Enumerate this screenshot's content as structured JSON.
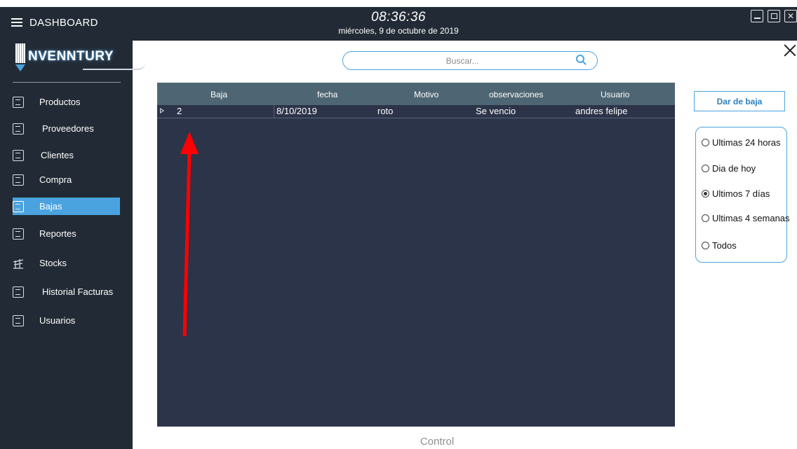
{
  "header": {
    "menu_label": "DASHBOARD",
    "time": "08:36:36",
    "date": "miércoles, 9 de octubre de 2019"
  },
  "sidebar": {
    "logo_text": "NVENNTURY",
    "items": [
      {
        "label": "Productos",
        "icon": "box-icon",
        "active": false
      },
      {
        "label": "Proveedores",
        "icon": "suppliers-icon",
        "active": false
      },
      {
        "label": "Clientes",
        "icon": "clients-icon",
        "active": false
      },
      {
        "label": "Compra",
        "icon": "purchase-icon",
        "active": false
      },
      {
        "label": "Bajas",
        "icon": "removals-icon",
        "active": true
      },
      {
        "label": "Reportes",
        "icon": "reports-icon",
        "active": false
      },
      {
        "label": "Stocks",
        "icon": "stocks-icon",
        "active": false
      },
      {
        "label": "Historial Facturas",
        "icon": "invoice-history-icon",
        "active": false
      },
      {
        "label": "Usuarios",
        "icon": "users-icon",
        "active": false
      }
    ]
  },
  "search": {
    "placeholder": "Buscar...",
    "value": ""
  },
  "grid": {
    "columns": [
      "Baja",
      "fecha",
      "Motivo",
      "observaciones",
      "Usuario"
    ],
    "rows": [
      {
        "baja": "2",
        "fecha": "8/10/2019",
        "motivo": "roto",
        "observaciones": "Se vencio",
        "usuario": "andres felipe"
      }
    ]
  },
  "actions": {
    "dar_de_baja": "Dar de baja"
  },
  "filters": {
    "options": [
      "Ultimas 24 horas",
      "Dia de hoy",
      "Ultimos 7 días",
      "Ultimas 4 semanas",
      "Todos"
    ],
    "selected": "Ultimos 7 días"
  },
  "footer": {
    "label": "Control"
  },
  "colors": {
    "sidebar_bg": "#222b35",
    "accent": "#4aa3df",
    "grid_bg": "#2c3449",
    "grid_header": "#4e6673",
    "annotation_arrow": "#ff0000"
  }
}
